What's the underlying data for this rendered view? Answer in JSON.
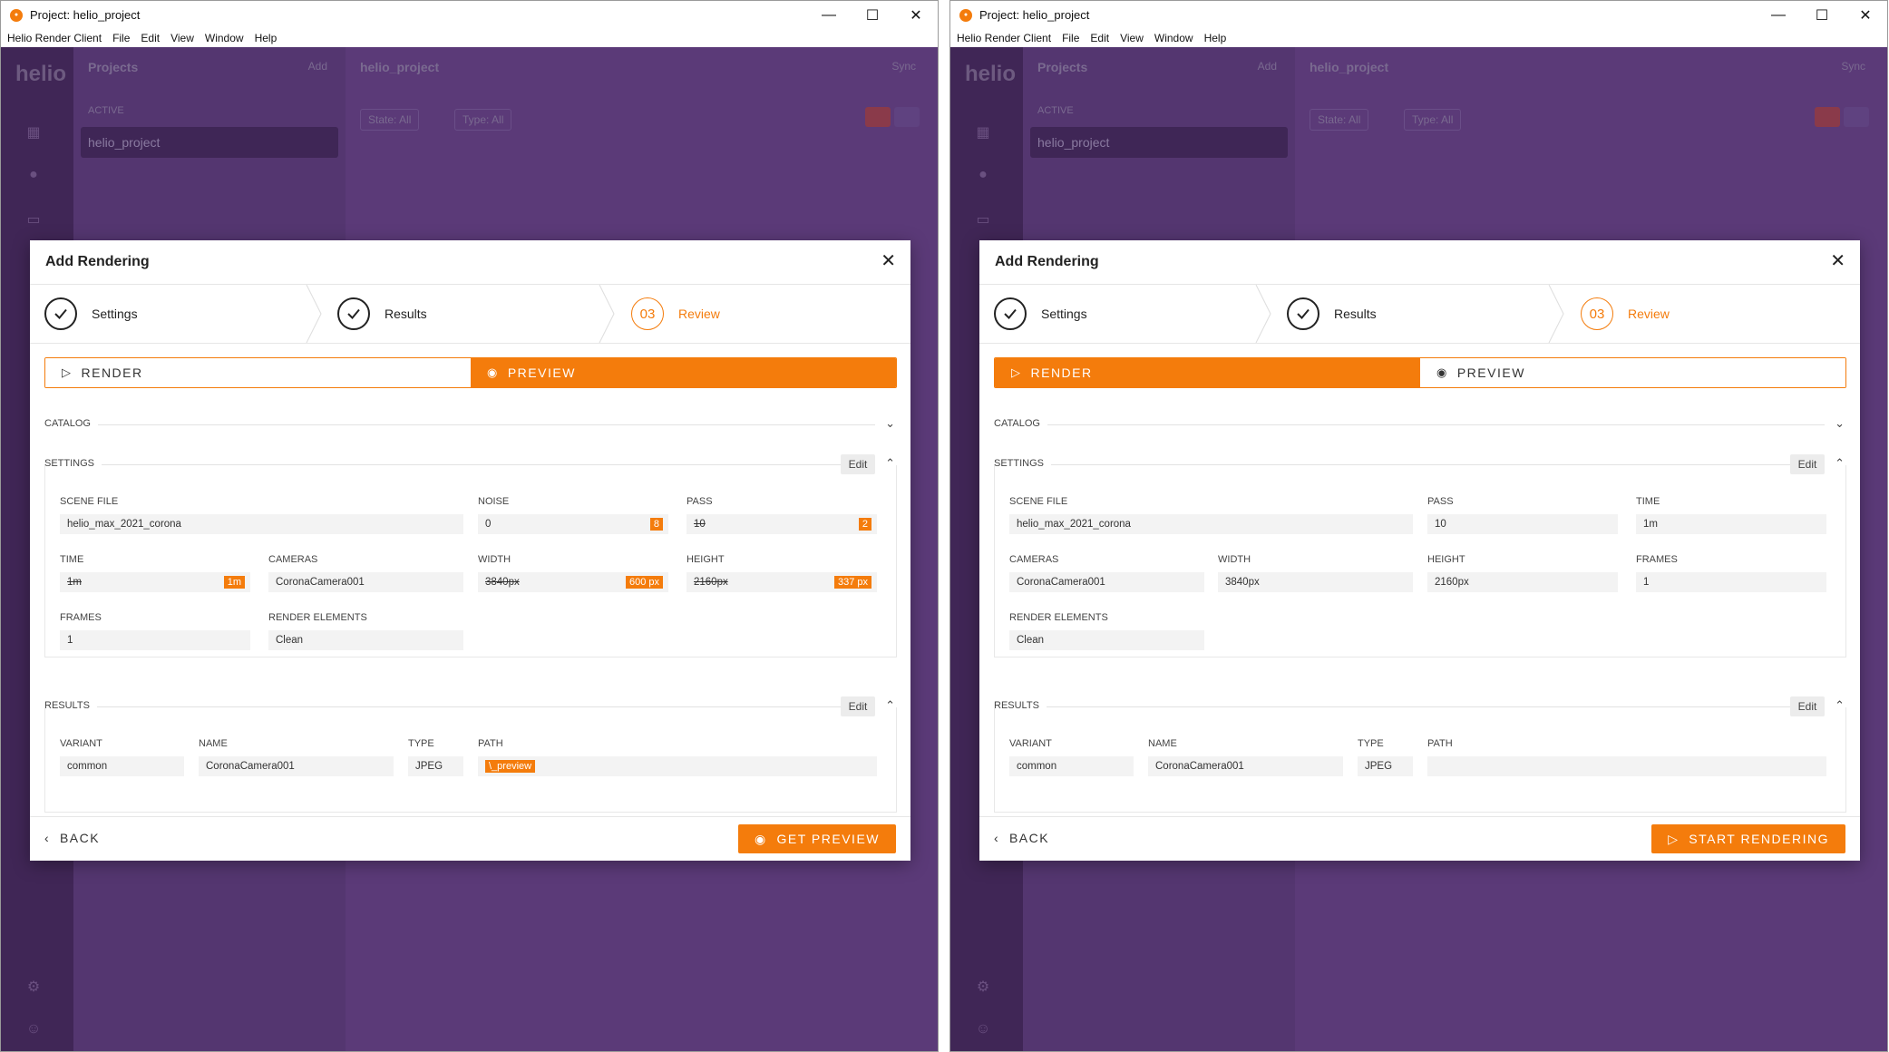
{
  "left": {
    "window_title": "Project: helio_project",
    "menu": [
      "Helio Render Client",
      "File",
      "Edit",
      "View",
      "Window",
      "Help"
    ],
    "app": {
      "brand": "helio",
      "projects_title": "Projects",
      "add_label": "Add",
      "active_label": "ACTIVE",
      "project_name": "helio_project",
      "main_title": "helio_project",
      "sync_label": "Sync",
      "filter_state": "State: All",
      "filter_type": "Type: All"
    },
    "dialog": {
      "title": "Add Rendering",
      "steps": [
        {
          "label": "Settings",
          "marker": "check"
        },
        {
          "label": "Results",
          "marker": "check"
        },
        {
          "label": "Review",
          "marker": "03"
        }
      ],
      "toggle": {
        "render": "RENDER",
        "preview": "PREVIEW",
        "selected": "preview"
      },
      "catalog_label": "CATALOG",
      "settings_label": "SETTINGS",
      "edit_label": "Edit",
      "settings_fields": [
        {
          "label": "SCENE FILE",
          "value": "helio_max_2021_corona"
        },
        {
          "label": "NOISE",
          "value": "0",
          "override": "8"
        },
        {
          "label": "PASS",
          "value": "10",
          "override": "2",
          "struck": true
        },
        {
          "label": "TIME",
          "value": "1m",
          "override": "1m",
          "struck": true
        },
        {
          "label": "CAMERAS",
          "value": "CoronaCamera001"
        },
        {
          "label": "WIDTH",
          "value": "3840px",
          "override": "600 px",
          "struck": true
        },
        {
          "label": "HEIGHT",
          "value": "2160px",
          "override": "337 px",
          "struck": true
        },
        {
          "label": "FRAMES",
          "value": "1"
        },
        {
          "label": "RENDER ELEMENTS",
          "value": "Clean"
        }
      ],
      "results_label": "RESULTS",
      "results_fields": [
        {
          "label": "VARIANT",
          "value": "common"
        },
        {
          "label": "NAME",
          "value": "CoronaCamera001"
        },
        {
          "label": "TYPE",
          "value": "JPEG"
        },
        {
          "label": "PATH",
          "value": "\\_preview"
        }
      ],
      "back_label": "BACK",
      "primary_label": "GET PREVIEW"
    }
  },
  "right": {
    "window_title": "Project: helio_project",
    "menu": [
      "Helio Render Client",
      "File",
      "Edit",
      "View",
      "Window",
      "Help"
    ],
    "app": {
      "brand": "helio",
      "projects_title": "Projects",
      "add_label": "Add",
      "active_label": "ACTIVE",
      "project_name": "helio_project",
      "main_title": "helio_project",
      "sync_label": "Sync",
      "filter_state": "State: All",
      "filter_type": "Type: All"
    },
    "dialog": {
      "title": "Add Rendering",
      "steps": [
        {
          "label": "Settings",
          "marker": "check"
        },
        {
          "label": "Results",
          "marker": "check"
        },
        {
          "label": "Review",
          "marker": "03"
        }
      ],
      "toggle": {
        "render": "RENDER",
        "preview": "PREVIEW",
        "selected": "render"
      },
      "catalog_label": "CATALOG",
      "settings_label": "SETTINGS",
      "edit_label": "Edit",
      "settings_fields": [
        {
          "label": "SCENE FILE",
          "value": "helio_max_2021_corona"
        },
        {
          "label": "PASS",
          "value": "10"
        },
        {
          "label": "TIME",
          "value": "1m"
        },
        {
          "label": "CAMERAS",
          "value": "CoronaCamera001"
        },
        {
          "label": "WIDTH",
          "value": "3840px"
        },
        {
          "label": "HEIGHT",
          "value": "2160px"
        },
        {
          "label": "FRAMES",
          "value": "1"
        },
        {
          "label": "RENDER ELEMENTS",
          "value": "Clean"
        }
      ],
      "results_label": "RESULTS",
      "results_fields": [
        {
          "label": "VARIANT",
          "value": "common"
        },
        {
          "label": "NAME",
          "value": "CoronaCamera001"
        },
        {
          "label": "TYPE",
          "value": "JPEG"
        },
        {
          "label": "PATH",
          "value": ""
        }
      ],
      "back_label": "BACK",
      "primary_label": "START RENDERING"
    }
  },
  "colors": {
    "accent": "#f47c0c",
    "backdrop": "#5b3a78"
  }
}
